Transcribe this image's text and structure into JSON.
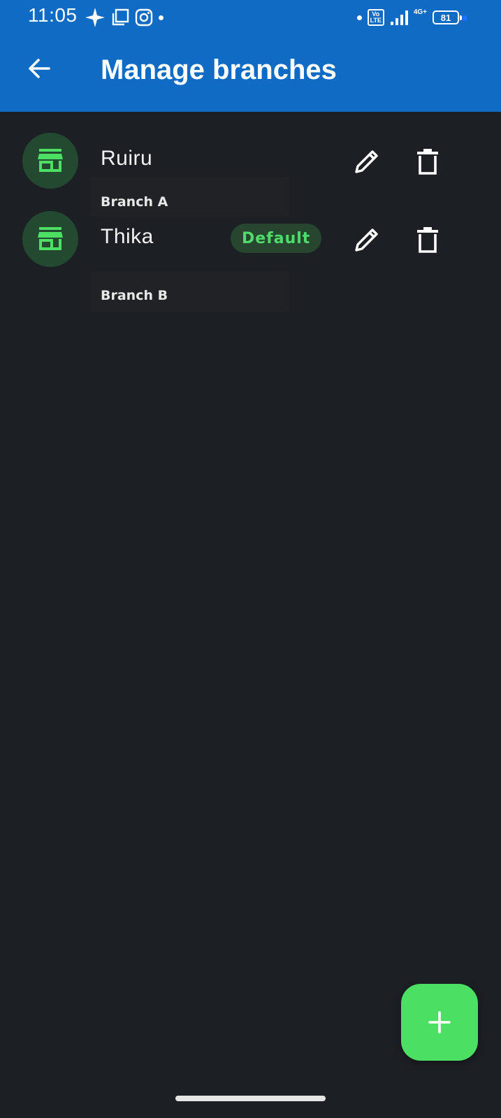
{
  "status_bar": {
    "time": "11:05",
    "volte_top": "Vo",
    "volte_bottom": "LTE",
    "network": "4G+",
    "battery": "81"
  },
  "app_bar": {
    "title": "Manage branches",
    "back_icon": "arrow-left-icon"
  },
  "branches": [
    {
      "name": "Ruiru",
      "tooltip": "Branch A",
      "default": false
    },
    {
      "name": "Thika",
      "tooltip": "Branch B",
      "default": true,
      "badge": "Default"
    }
  ],
  "icons": {
    "store": "storefront-icon",
    "edit": "pencil-icon",
    "delete": "trash-icon",
    "add": "plus-icon"
  },
  "colors": {
    "app_bar": "#0f6bc4",
    "background": "#1c1f24",
    "accent_green": "#4be063",
    "avatar_bg": "#234a31",
    "badge_text": "#4fdc6a"
  }
}
